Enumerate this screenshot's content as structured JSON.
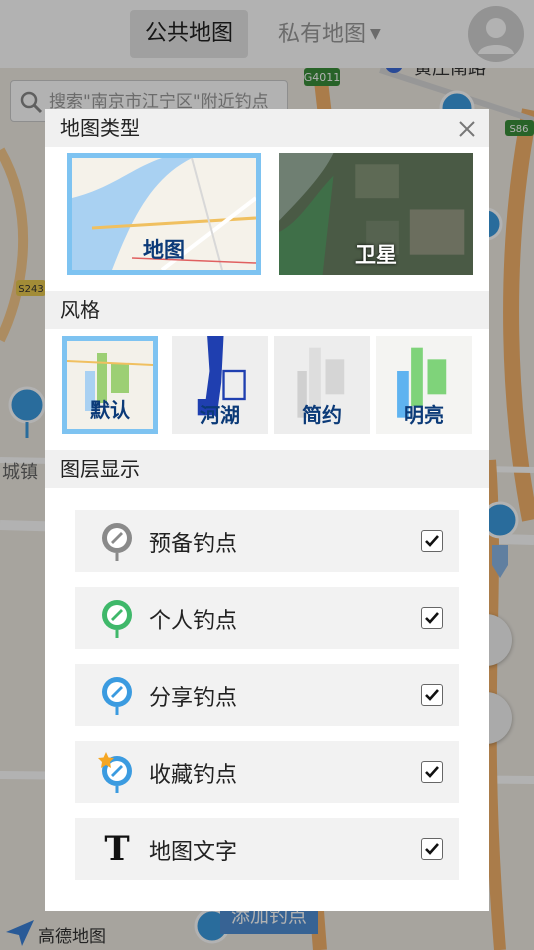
{
  "topbar": {
    "tab_public": "公共地图",
    "tab_private": "私有地图",
    "search_placeholder": "搜索\"南京市江宁区\"附近钓点"
  },
  "map": {
    "labels": {
      "g4011": "G4011",
      "s86": "S86",
      "s243": "S243",
      "town": "城镇",
      "road_name": "黄庄南路"
    },
    "add_spot": "添加钓点",
    "logo": "高德地图"
  },
  "modal": {
    "sections": {
      "map_type": "地图类型",
      "style": "风格",
      "layers": "图层显示"
    },
    "map_types": [
      {
        "label": "地图",
        "selected": true
      },
      {
        "label": "卫星",
        "selected": false
      }
    ],
    "styles": [
      {
        "label": "默认",
        "selected": true
      },
      {
        "label": "河湖",
        "selected": false
      },
      {
        "label": "简约",
        "selected": false
      },
      {
        "label": "明亮",
        "selected": false
      }
    ],
    "layers": [
      {
        "label": "预备钓点",
        "checked": true,
        "icon": "gray-pin-icon",
        "color": "#8a8a8a"
      },
      {
        "label": "个人钓点",
        "checked": true,
        "icon": "green-pin-icon",
        "color": "#3fb86a"
      },
      {
        "label": "分享钓点",
        "checked": true,
        "icon": "blue-pin-icon",
        "color": "#3b9be0"
      },
      {
        "label": "收藏钓点",
        "checked": true,
        "icon": "star-pin-icon",
        "color": "#3b9be0"
      },
      {
        "label": "地图文字",
        "checked": true,
        "icon": "text-t-icon",
        "glyph": "T"
      }
    ]
  },
  "colors": {
    "selected_border": "#7ec3f1",
    "thumb_label": "#0b3a78",
    "add_spot_bg": "#4f8fd4"
  }
}
